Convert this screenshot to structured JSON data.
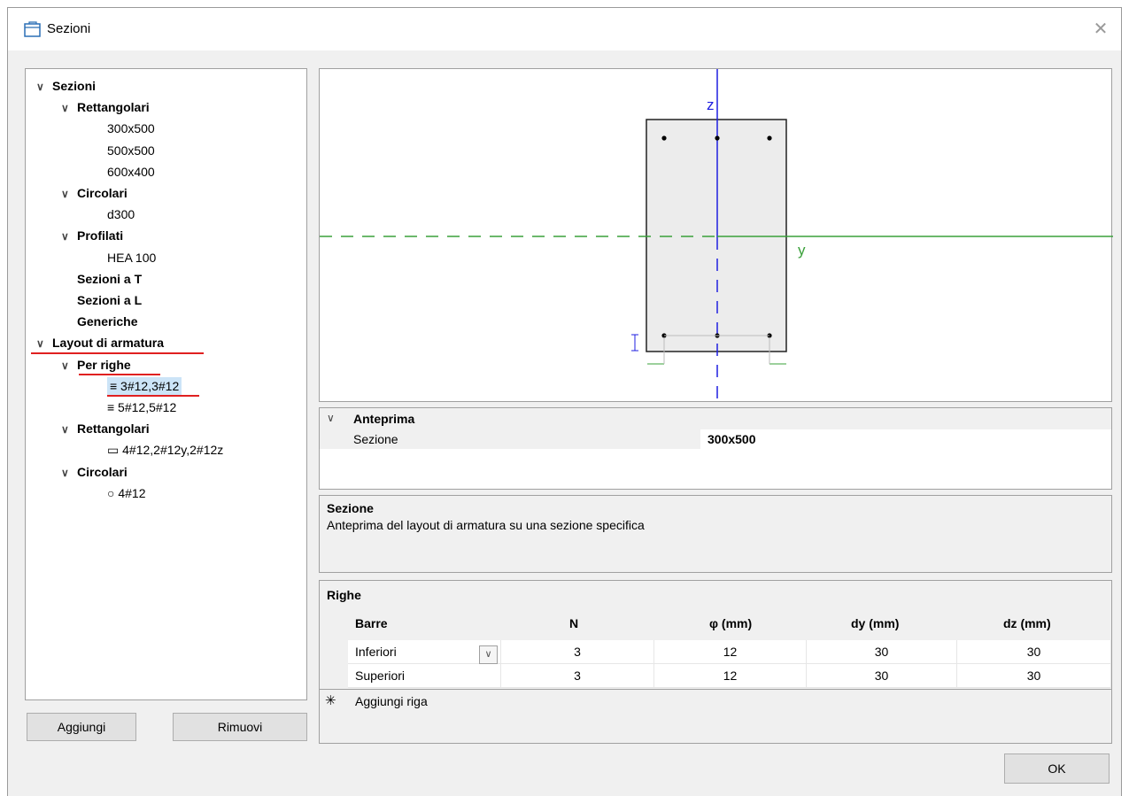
{
  "window": {
    "title": "Sezioni",
    "close_glyph": "✕"
  },
  "tree": [
    {
      "label": "Sezioni",
      "bold": true,
      "chevron": true,
      "level": 0
    },
    {
      "label": "Rettangolari",
      "bold": true,
      "chevron": true,
      "level": 1
    },
    {
      "label": "300x500",
      "level": 2
    },
    {
      "label": "500x500",
      "level": 2
    },
    {
      "label": "600x400",
      "level": 2
    },
    {
      "label": "Circolari",
      "bold": true,
      "chevron": true,
      "level": 1
    },
    {
      "label": "d300",
      "level": 2
    },
    {
      "label": "Profilati",
      "bold": true,
      "chevron": true,
      "level": 1
    },
    {
      "label": "HEA 100",
      "level": 2
    },
    {
      "label": "Sezioni a T",
      "bold": true,
      "level": 1
    },
    {
      "label": "Sezioni a L",
      "bold": true,
      "level": 1
    },
    {
      "label": "Generiche",
      "bold": true,
      "level": 1
    },
    {
      "label": "Layout di armatura",
      "bold": true,
      "chevron": true,
      "level": 0
    },
    {
      "label": "Per righe",
      "bold": true,
      "chevron": true,
      "level": 1
    },
    {
      "label": "≡ 3#12,3#12",
      "level": 2,
      "selected": true
    },
    {
      "label": "≡ 5#12,5#12",
      "level": 2
    },
    {
      "label": "Rettangolari",
      "bold": true,
      "chevron": true,
      "level": 1
    },
    {
      "label": "▭ 4#12,2#12y,2#12z",
      "level": 2
    },
    {
      "label": "Circolari",
      "bold": true,
      "chevron": true,
      "level": 1
    },
    {
      "label": "○ 4#12",
      "level": 2
    }
  ],
  "buttons": {
    "add": "Aggiungi",
    "remove": "Rimuovi",
    "ok": "OK"
  },
  "drawing": {
    "axis_z": "z",
    "axis_y": "y",
    "axis_z_color": "#1f1fe0",
    "axis_y_color": "#3aa03a"
  },
  "property_grid": {
    "category": "Anteprima",
    "rows": [
      {
        "name": "Sezione",
        "value": "300x500"
      }
    ]
  },
  "description": {
    "title": "Sezione",
    "text": "Anteprima del layout di armatura su una sezione specifica"
  },
  "rows_grid": {
    "title": "Righe",
    "headers": [
      "Barre",
      "N",
      "φ (mm)",
      "dy (mm)",
      "dz (mm)"
    ],
    "rows": [
      [
        "Inferiori",
        "3",
        "12",
        "30",
        "30"
      ],
      [
        "Superiori",
        "3",
        "12",
        "30",
        "30"
      ]
    ],
    "add_row_label": "Aggiungi riga",
    "add_row_glyph": "✳"
  },
  "colors": {
    "selection": "#cce4f7",
    "annotation_red": "#e02020"
  }
}
